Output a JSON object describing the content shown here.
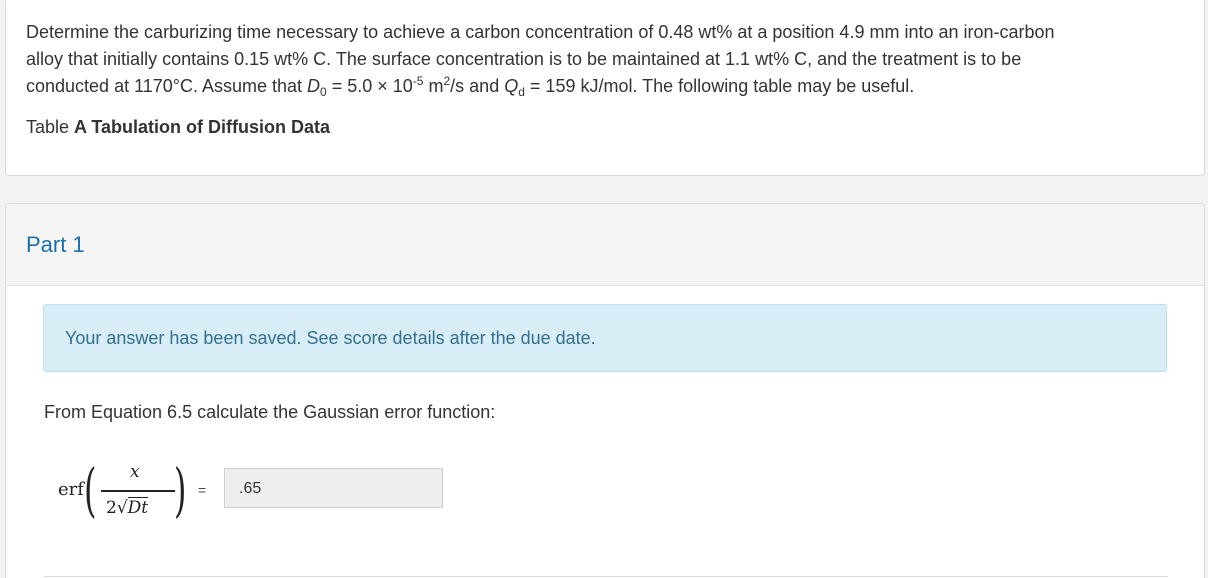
{
  "question": {
    "text_line1": "Determine the carburizing time necessary to achieve a carbon concentration of 0.48 wt% at a position 4.9 mm into an iron-carbon",
    "text_line2": "alloy that initially contains 0.15 wt% C. The surface concentration is to be maintained at 1.1 wt% C, and the treatment is to be",
    "text_line3_a": "conducted at 1170°C. Assume that ",
    "d_symbol": "D",
    "d_sub": "0",
    "text_line3_b": " = 5.0 × 10",
    "exp_sup": "-5",
    "text_line3_c": " m",
    "m_sup": "2",
    "text_line3_d": "/s and ",
    "q_symbol": "Q",
    "q_sub": "d",
    "text_line3_e": " = 159 kJ/mol. The following table may be useful.",
    "table_prefix": "Table ",
    "table_link": "A Tabulation of Diffusion Data"
  },
  "part": {
    "title": "Part 1",
    "alert": "Your answer has been saved. See score details after the due date.",
    "instruction": "From Equation 6.5 calculate the Gaussian error function:"
  },
  "formula": {
    "erf": "erf",
    "numerator": "x",
    "den_coef": "2",
    "radical": "√",
    "radicand": "Dt",
    "equals": "="
  },
  "answer": {
    "value": ".65"
  },
  "colors": {
    "part_title": "#1a6fb0",
    "alert_bg": "#d9edf7",
    "alert_text": "#31708f"
  }
}
